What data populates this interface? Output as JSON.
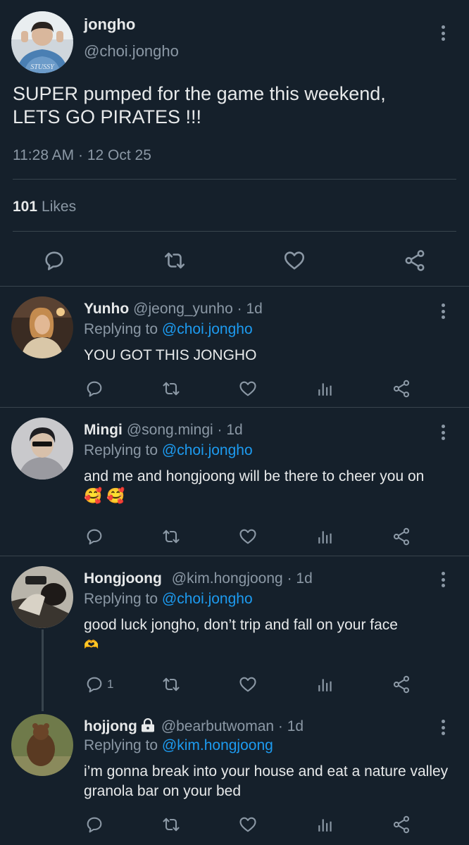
{
  "main_tweet": {
    "name": "jongho",
    "handle": "@choi.jongho",
    "text_line1": "SUPER pumped for the game this weekend,",
    "text_line2": "LETS GO PIRATES !!!",
    "timestamp": "11:28 AM · 12 Oct 25",
    "likes_count": "101",
    "likes_label": "Likes",
    "actions": [
      "reply-icon",
      "retweet-icon",
      "like-icon",
      "share-icon"
    ]
  },
  "replies": [
    {
      "name": "Yunho",
      "handle": "@jeong_yunho",
      "time": "· 1d",
      "replying_prefix": "Replying to",
      "replying_to": "@choi.jongho",
      "body": "YOU GOT THIS JONGHO",
      "reply_count": ""
    },
    {
      "name": "Mingi",
      "handle": "@song.mingi",
      "time": "· 1d",
      "replying_prefix": "Replying to",
      "replying_to": "@choi.jongho",
      "body": "and me and hongjoong will be there to cheer you on",
      "emoji": "🥰 🥰",
      "reply_count": ""
    },
    {
      "name": "Hongjoong",
      "handle": "@kim.hongjoong",
      "time": "· 1d",
      "replying_prefix": "Replying to",
      "replying_to": "@choi.jongho",
      "body": "good luck jongho, don’t trip and fall on your face",
      "emoji": "🫶",
      "reply_count": "1"
    },
    {
      "name": "hojjong",
      "handle": "@bearbutwoman",
      "time": "· 1d",
      "replying_prefix": "Replying to",
      "replying_to": "@kim.hongjoong",
      "body": "i’m gonna break into your house and eat a nature valley granola bar on your bed",
      "reply_count": ""
    }
  ],
  "colors": {
    "background": "#15202b",
    "text": "#e7e9ea",
    "muted": "#8b98a5",
    "link": "#1d9bf0",
    "divider": "#38444d"
  }
}
